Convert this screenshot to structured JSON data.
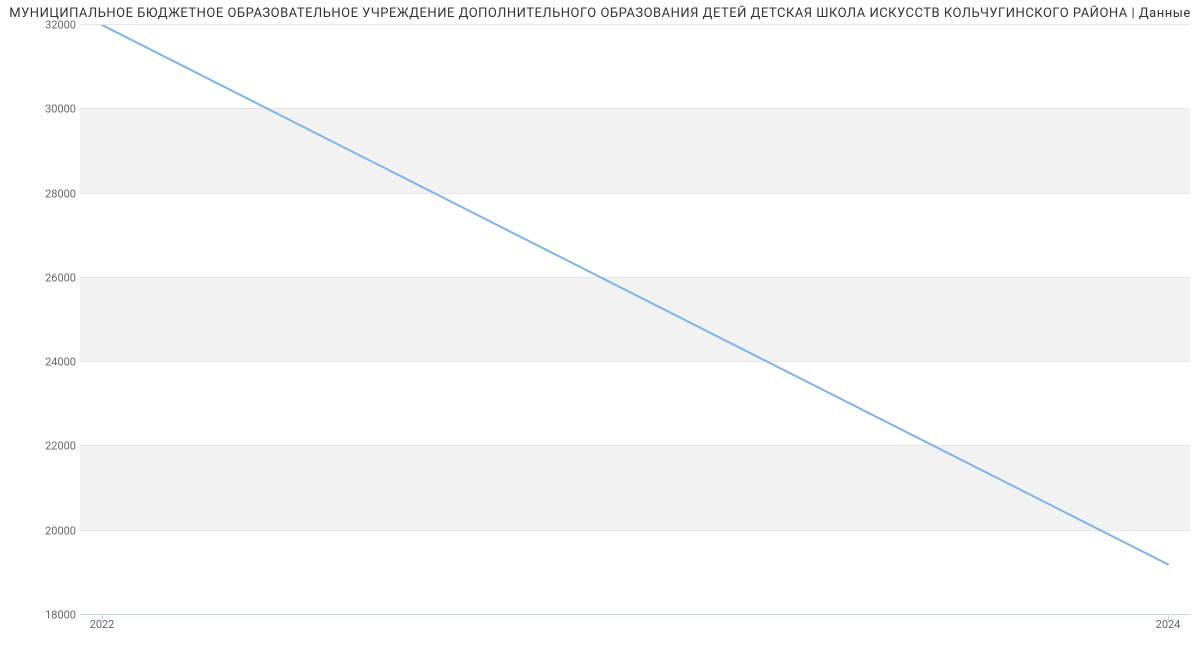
{
  "chart_data": {
    "type": "line",
    "title": "МУНИЦИПАЛЬНОЕ БЮДЖЕТНОЕ ОБРАЗОВАТЕЛЬНОЕ УЧРЕЖДЕНИЕ ДОПОЛНИТЕЛЬНОГО ОБРАЗОВАНИЯ ДЕТЕЙ ДЕТСКАЯ ШКОЛА ИСКУССТВ КОЛЬЧУГИНСКОГО РАЙОНА | Данные",
    "x": [
      2022,
      2024
    ],
    "values": [
      32000,
      19200
    ],
    "xlabel": "",
    "ylabel": "",
    "ylim": [
      18000,
      32000
    ],
    "y_ticks": [
      18000,
      20000,
      22000,
      24000,
      26000,
      28000,
      30000,
      32000
    ],
    "x_ticks": [
      2022,
      2024
    ],
    "line_color": "#7cb5ec"
  }
}
